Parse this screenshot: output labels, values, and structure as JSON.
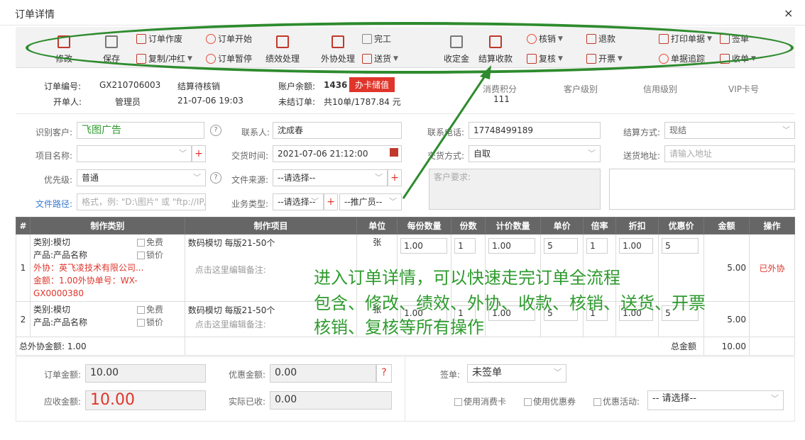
{
  "window": {
    "title": "订单详情",
    "close_glyph": "×"
  },
  "toolbar": {
    "edit": "修改",
    "save": "保存",
    "void": "订单作废",
    "copy": "复制/冲红",
    "start": "订单开始",
    "pause": "订单暂停",
    "perf": "绩效处理",
    "outsource": "外协处理",
    "finish": "完工",
    "deliver": "送货",
    "deposit": "收定金",
    "settle": "结算收款",
    "verify": "核销",
    "recheck": "复核",
    "refund": "退款",
    "invoice": "开票",
    "print": "打印单据",
    "track": "单据追踪",
    "sign": "签单",
    "receipt": "收单"
  },
  "info": {
    "order_no_label": "订单编号:",
    "order_no": "GX210706003",
    "order_status": "结算待核销",
    "creator_label": "开单人:",
    "creator": "管理员",
    "created": "21-07-06 19:03",
    "balance_label": "账户余额:",
    "balance": "1436",
    "card_btn": "办卡储值",
    "unsettled_label": "未结订单:",
    "unsettled": "共10单/1787.84 元",
    "points_label": "消费积分",
    "points": "111",
    "cust_level": "客户级别",
    "credit_level": "信用级别",
    "vip_card": "VIP卡号"
  },
  "form": {
    "customer_label": "识别客户:",
    "customer": "飞图广告",
    "contact_label": "联系人:",
    "contact": "沈成春",
    "phone_label": "联系电话:",
    "phone": "17748499189",
    "settle_label": "结算方式:",
    "settle": "现结",
    "project_label": "项目名称:",
    "delivery_time_label": "交货时间:",
    "delivery_time": "2021-07-06 21:12:00",
    "delivery_method_label": "交货方式:",
    "delivery_method": "自取",
    "address_label": "送货地址:",
    "address_ph": "请输入地址",
    "priority_label": "优先级:",
    "priority": "普通",
    "source_label": "文件来源:",
    "source": "--请选择--",
    "requirement_ph": "客户要求:",
    "path_label": "文件路径:",
    "path_ph": "格式，例: \"D:\\图片\" 或 \"ftp://IP/\"",
    "biz_label": "业务类型:",
    "biz": "--请选择--",
    "promoter": "--推广员--"
  },
  "table": {
    "headers": [
      "#",
      "制作类别",
      "制作项目",
      "单位",
      "每份数量",
      "份数",
      "计价数量",
      "单价",
      "倍率",
      "折扣",
      "优惠价",
      "金额",
      "操作"
    ],
    "rows": [
      {
        "no": "1",
        "cat": "类别:模切",
        "prod": "产品:产品名称",
        "outsrc": "外协：英飞凌技术有限公司...",
        "amount_line": "金额：1.00外协单号：WX-GX0000380",
        "free": "免费",
        "lock": "锁价",
        "item": "数码模切 每版21-50个",
        "remark": "点击这里编辑备注:",
        "unit": "张",
        "qty": "1.00",
        "copies": "1",
        "calc": "1.00",
        "price": "5",
        "rate": "1",
        "disc": "1.00",
        "promo": "5",
        "total": "5.00",
        "op": "已外协"
      },
      {
        "no": "2",
        "cat": "类别:模切",
        "prod": "产品:产品名称",
        "free": "免费",
        "lock": "锁价",
        "item": "数码模切 每版21-50个",
        "remark": "点击这里编辑备注:",
        "unit": "张",
        "qty": "1.00",
        "copies": "1",
        "calc": "1.00",
        "price": "5",
        "rate": "1",
        "disc": "1.00",
        "promo": "5",
        "total": "5.00",
        "op": ""
      }
    ],
    "outsource_total_label": "总外协金额:",
    "outsource_total": "1.00",
    "grand_label": "总金额",
    "grand_total": "10.00"
  },
  "summary": {
    "order_amt_label": "订单金额:",
    "order_amt": "10.00",
    "discount_label": "优惠金额:",
    "discount": "0.00",
    "help": "?",
    "receivable_label": "应收金额:",
    "receivable": "10.00",
    "paid_label": "实际已收:",
    "paid": "0.00",
    "sign_label": "签单:",
    "sign_value": "未签单",
    "use_card": "使用消费卡",
    "use_coupon": "使用优惠券",
    "promo_label": "优惠活动:",
    "promo_value": "-- 请选择--"
  },
  "overlay": {
    "line1": "进入订单详情，可以快速走完订单全流程",
    "line2": "包含、修改、绩效、外协、收款、核销、送货、开票",
    "line3": "核销、复核等所有操作"
  },
  "colors": {
    "annotation": "#2e8b2e",
    "accent": "#e0352b",
    "header": "#666666"
  }
}
